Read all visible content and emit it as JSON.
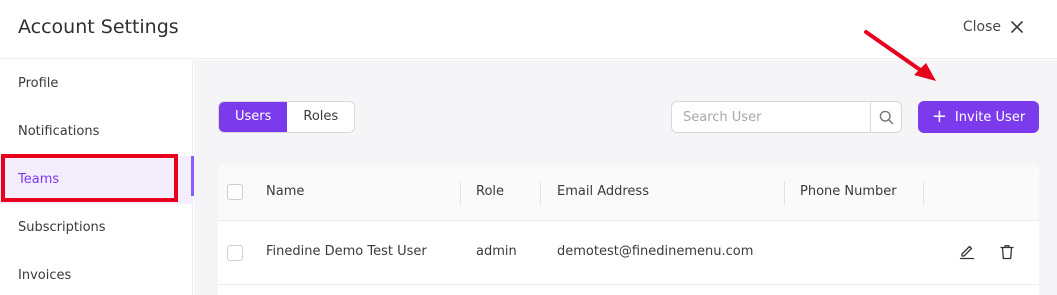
{
  "header": {
    "title": "Account Settings",
    "close_label": "Close"
  },
  "sidebar": {
    "items": [
      {
        "label": "Profile"
      },
      {
        "label": "Notifications"
      },
      {
        "label": "Teams"
      },
      {
        "label": "Subscriptions"
      },
      {
        "label": "Invoices"
      }
    ],
    "active": "Teams"
  },
  "toolbar": {
    "tabs": [
      {
        "label": "Users"
      },
      {
        "label": "Roles"
      }
    ],
    "selected_tab": "Users",
    "search": {
      "placeholder": "Search User",
      "value": ""
    },
    "invite_label": "Invite User"
  },
  "table": {
    "columns": [
      "Name",
      "Role",
      "Email Address",
      "Phone Number"
    ],
    "rows": [
      {
        "name": "Finedine Demo Test User",
        "role": "admin",
        "email": "demotest@finedinemenu.com",
        "phone": ""
      }
    ]
  },
  "colors": {
    "accent": "#7c3aed",
    "annotation": "#e8001c"
  },
  "icons": [
    "close-icon",
    "search-icon",
    "plus-icon",
    "edit-icon",
    "trash-icon",
    "annotation-arrow"
  ]
}
